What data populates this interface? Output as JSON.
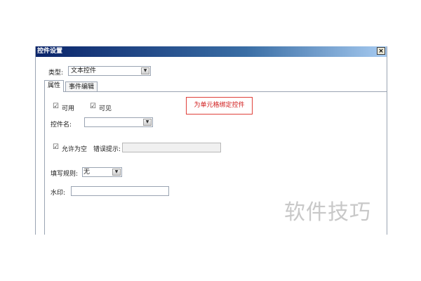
{
  "dialog": {
    "title": "控件设置",
    "close_glyph": "×"
  },
  "type_field": {
    "label": "类型:",
    "value": "文本控件"
  },
  "tabs": [
    {
      "label": "属性",
      "active": true
    },
    {
      "label": "事件编辑",
      "active": false
    }
  ],
  "properties": {
    "enabled_label": "可用",
    "enabled_checked": true,
    "visible_label": "可见",
    "visible_checked": true,
    "control_name_label": "控件名:",
    "control_name_value": "",
    "allow_empty_label": "允许为空",
    "allow_empty_checked": true,
    "error_hint_label": "错误提示:",
    "error_hint_value": "",
    "fill_rule_label": "填写规则:",
    "fill_rule_value": "无",
    "watermark_label": "水印:",
    "watermark_value": ""
  },
  "annotation": {
    "text": "为单元格绑定控件",
    "color": "#d01a1a"
  },
  "site_watermark": {
    "text": "软件技巧"
  },
  "icons": {
    "checkmark": "check-icon",
    "dropdown": "chevron-down-icon",
    "close": "close-icon"
  }
}
